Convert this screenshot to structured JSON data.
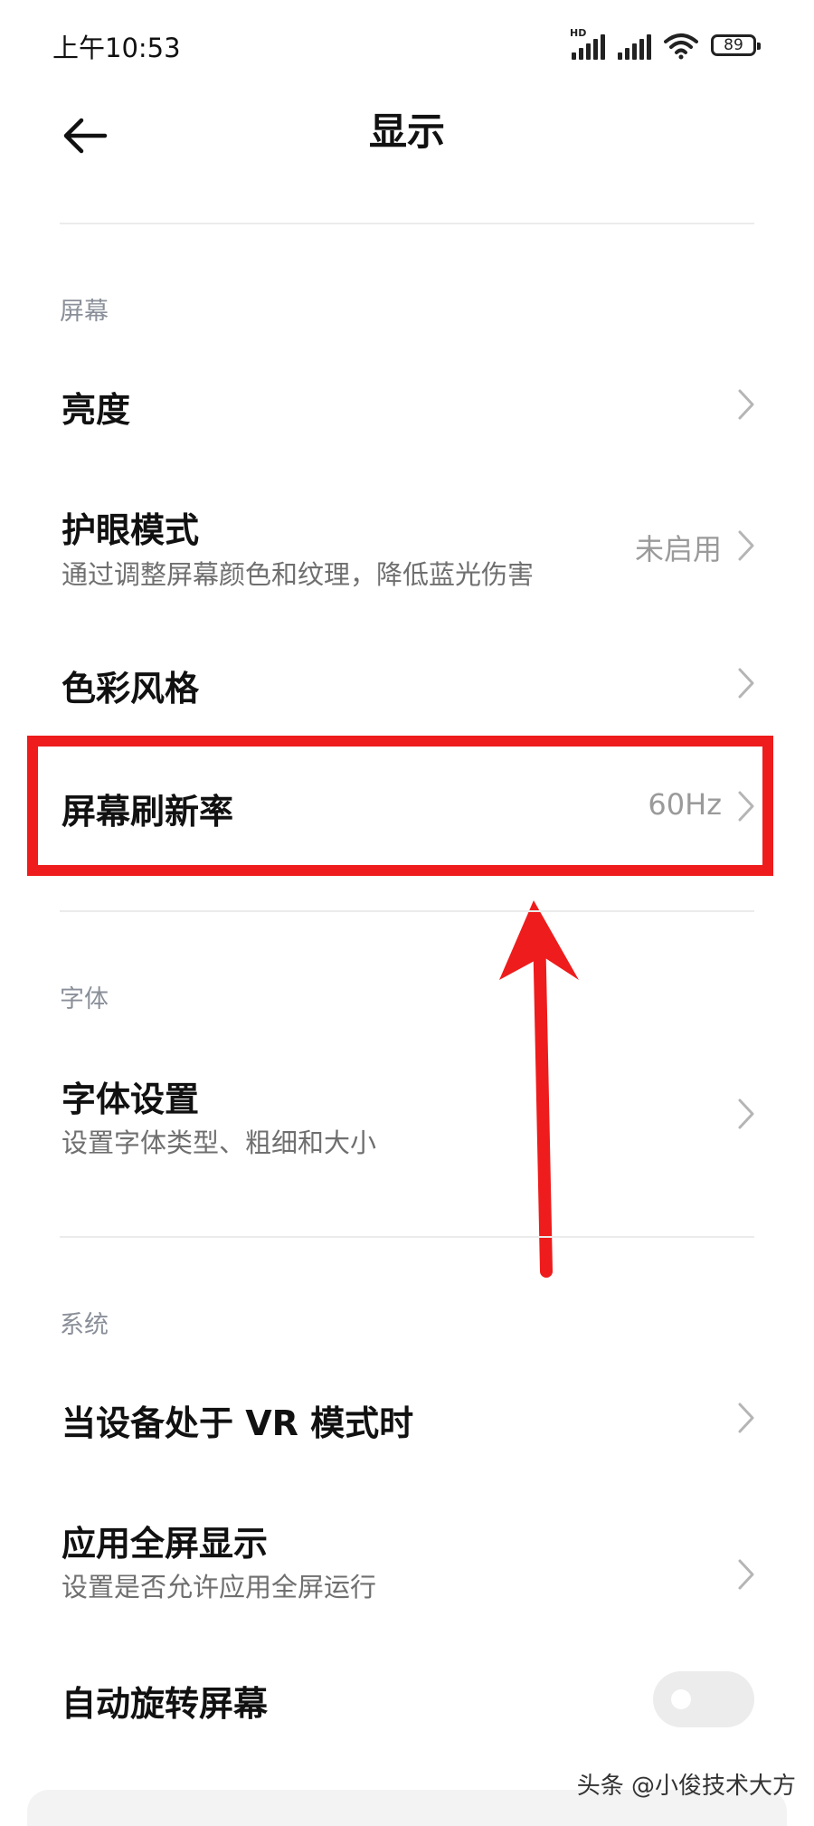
{
  "status_bar": {
    "time": "上午10:53",
    "hd_label": "HD",
    "battery": "89"
  },
  "header": {
    "title": "显示",
    "back_icon": "arrow-left-icon"
  },
  "sections": {
    "screen": "屏幕",
    "font": "字体",
    "system": "系统"
  },
  "items": {
    "brightness": {
      "label": "亮度"
    },
    "eye_care": {
      "label": "护眼模式",
      "sub": "通过调整屏幕颜色和纹理，降低蓝光伤害",
      "value": "未启用"
    },
    "color_style": {
      "label": "色彩风格"
    },
    "refresh_rate": {
      "label": "屏幕刷新率",
      "value": "60Hz"
    },
    "font_settings": {
      "label": "字体设置",
      "sub": "设置字体类型、粗细和大小"
    },
    "vr_mode": {
      "label": "当设备处于 VR 模式时"
    },
    "fullscreen_apps": {
      "label": "应用全屏显示",
      "sub": "设置是否允许应用全屏运行"
    },
    "auto_rotate": {
      "label": "自动旋转屏幕",
      "toggle_on": false
    }
  },
  "annotation": {
    "highlight_color": "#ee1c1c",
    "arrow_color": "#ee1c1c"
  },
  "watermark": "头条 @小俊技术大方"
}
